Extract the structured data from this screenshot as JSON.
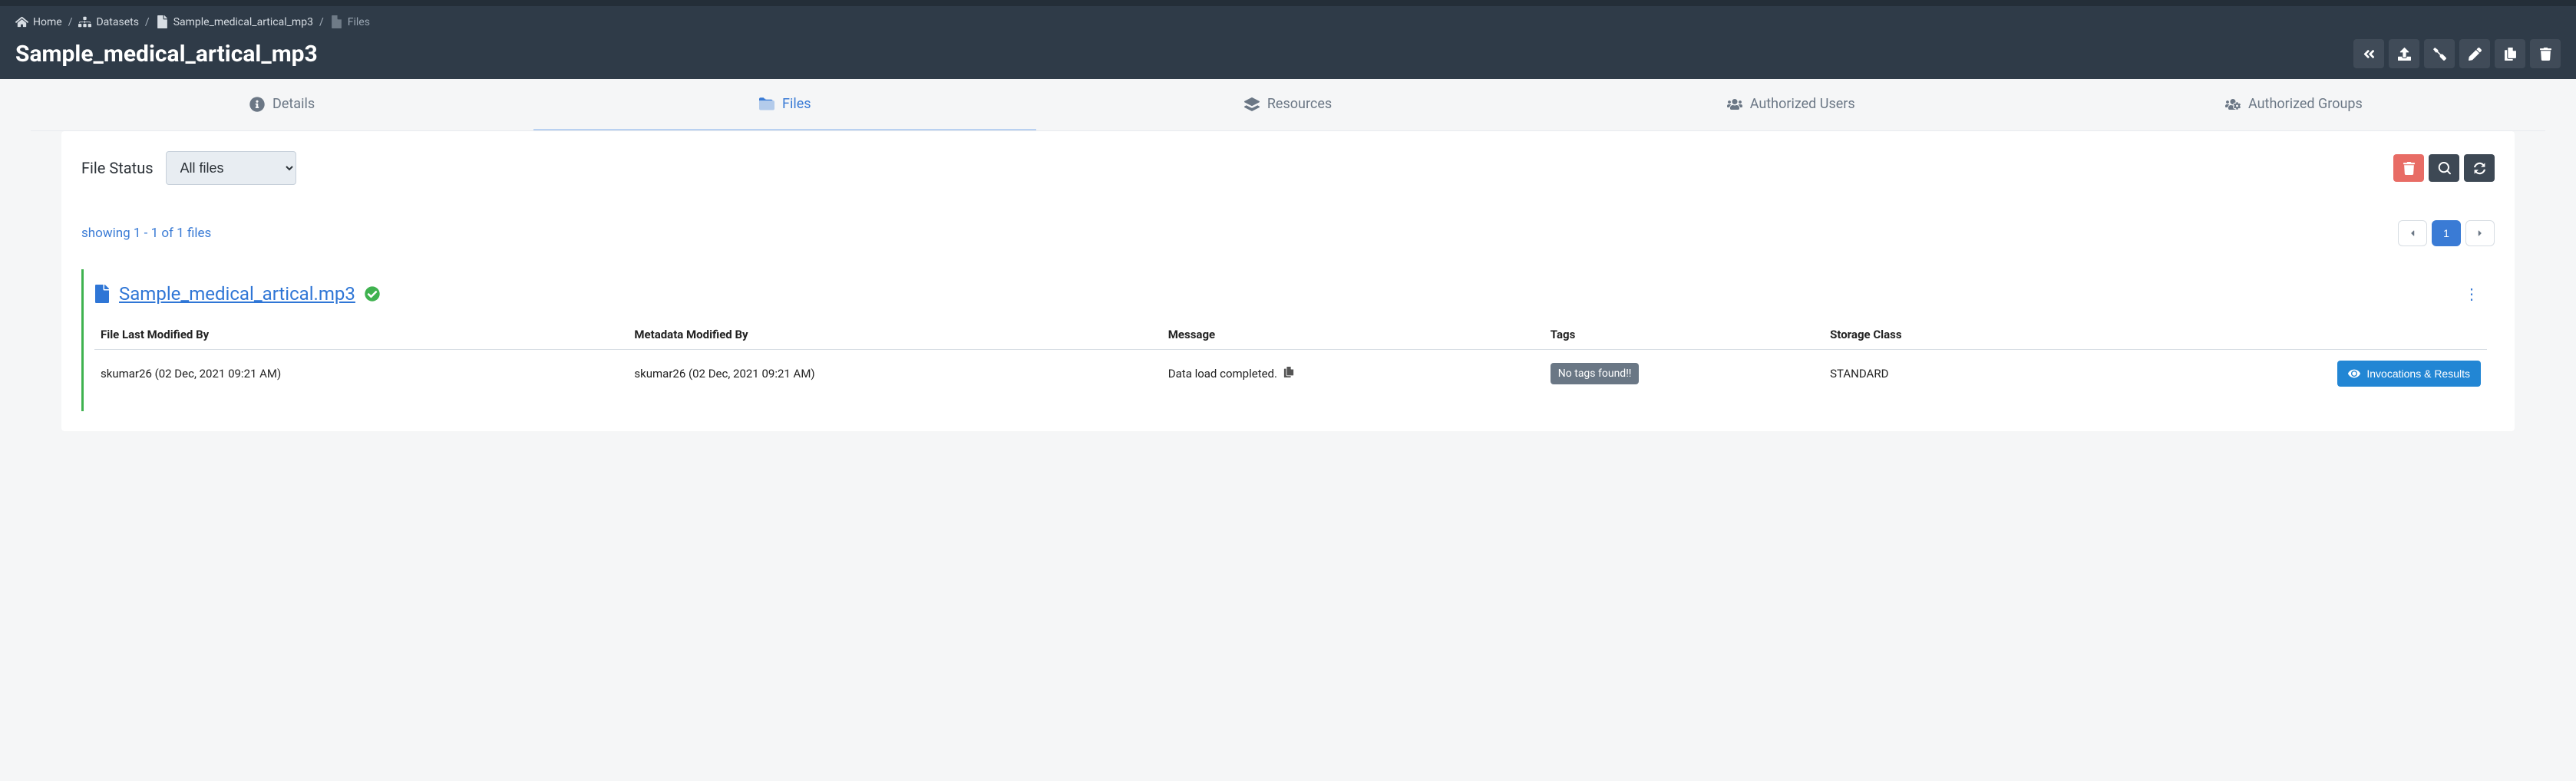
{
  "breadcrumb": {
    "home": "Home",
    "datasets": "Datasets",
    "dataset": "Sample_medical_artical_mp3",
    "current": "Files"
  },
  "page_title": "Sample_medical_artical_mp3",
  "tabs": {
    "details": "Details",
    "files": "Files",
    "resources": "Resources",
    "authorized_users": "Authorized Users",
    "authorized_groups": "Authorized Groups"
  },
  "filter": {
    "label": "File Status",
    "selected": "All files"
  },
  "listing": {
    "summary": "showing 1 - 1 of 1 files",
    "page_current": "1"
  },
  "file": {
    "name": "Sample_medical_artical.mp3",
    "columns": {
      "c0": "File Last Modified By",
      "c1": "Metadata Modified By",
      "c2": "Message",
      "c3": "Tags",
      "c4": "Storage Class"
    },
    "row": {
      "last_modified_by": "skumar26 (02 Dec, 2021 09:21 AM)",
      "metadata_modified_by": "skumar26 (02 Dec, 2021 09:21 AM)",
      "message": "Data load completed.",
      "tags": "No tags found!!",
      "storage_class": "STANDARD"
    },
    "invocations_btn": "Invocations & Results"
  }
}
